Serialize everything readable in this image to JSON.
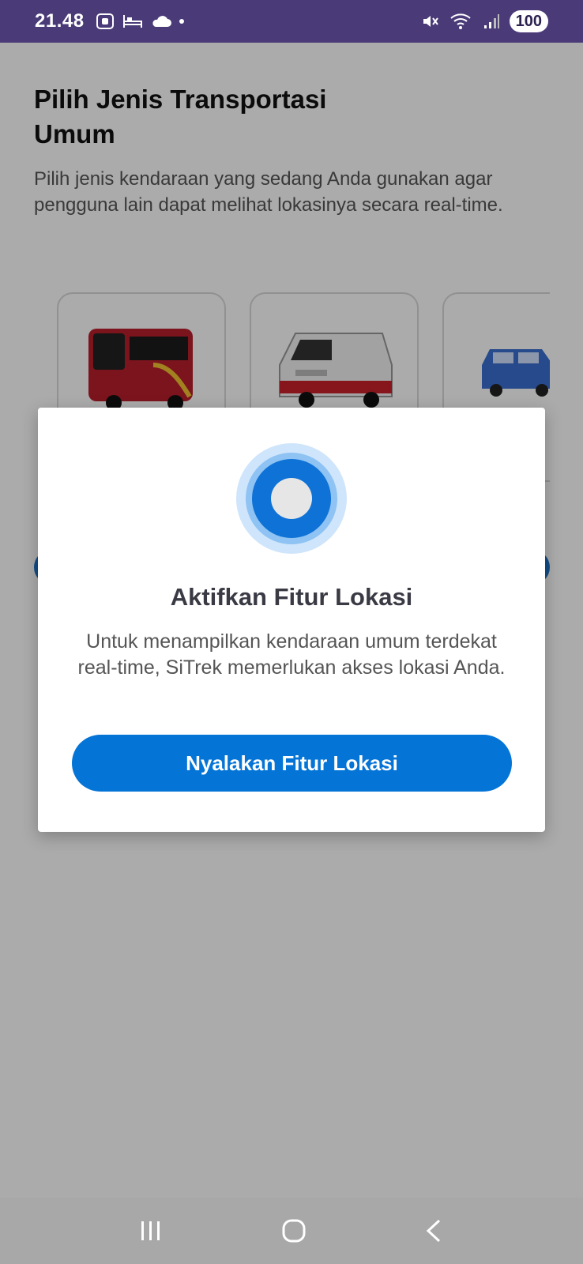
{
  "status_bar": {
    "time": "21.48",
    "battery": "100"
  },
  "page": {
    "title": "Pilih Jenis Transportasi Umum",
    "description": "Pilih jenis kendaraan yang sedang Anda gunakan agar pengguna lain dapat melihat lokasinya secara real-time.",
    "vehicles": [
      {
        "icon": "red-bus-image"
      },
      {
        "icon": "white-van-image"
      },
      {
        "icon": "blue-minivan-image"
      }
    ]
  },
  "dialog": {
    "title": "Aktifkan Fitur Lokasi",
    "description": "Untuk menampilkan kendaraan umum terdekat real-time, SiTrek memerlukan akses lokasi Anda.",
    "button_label": "Nyalakan Fitur Lokasi",
    "icon": "location-pulse-icon"
  },
  "colors": {
    "status_bar": "#4a3a78",
    "primary": "#0474d6"
  }
}
